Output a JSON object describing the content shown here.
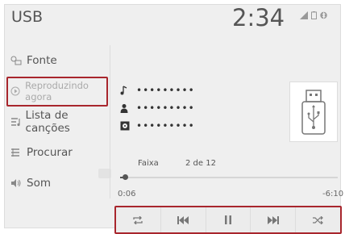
{
  "header": {
    "title": "USB",
    "time": "2:34"
  },
  "sidebar": {
    "items": [
      {
        "label": "Fonte",
        "icon": "source-icon"
      },
      {
        "label": "Reproduzindo agora",
        "icon": "play-circle-icon",
        "active": true
      },
      {
        "label": "Lista de canções",
        "icon": "song-list-icon"
      },
      {
        "label": "Procurar",
        "icon": "browse-icon"
      },
      {
        "label": "Som",
        "icon": "speaker-icon"
      }
    ]
  },
  "track": {
    "title": "•••••••••",
    "artist": "•••••••••",
    "album": "•••••••••",
    "track_label": "Faixa",
    "track_count": "2 de 12",
    "elapsed": "0:06",
    "remaining": "-6:10",
    "progress": 0.02
  },
  "controls": [
    {
      "name": "repeat",
      "icon": "repeat-icon"
    },
    {
      "name": "previous",
      "icon": "previous-track-icon"
    },
    {
      "name": "pause",
      "icon": "pause-icon"
    },
    {
      "name": "next",
      "icon": "next-track-icon"
    },
    {
      "name": "shuffle",
      "icon": "shuffle-icon"
    }
  ],
  "colors": {
    "highlight": "#a8262d",
    "background": "#efefef"
  }
}
